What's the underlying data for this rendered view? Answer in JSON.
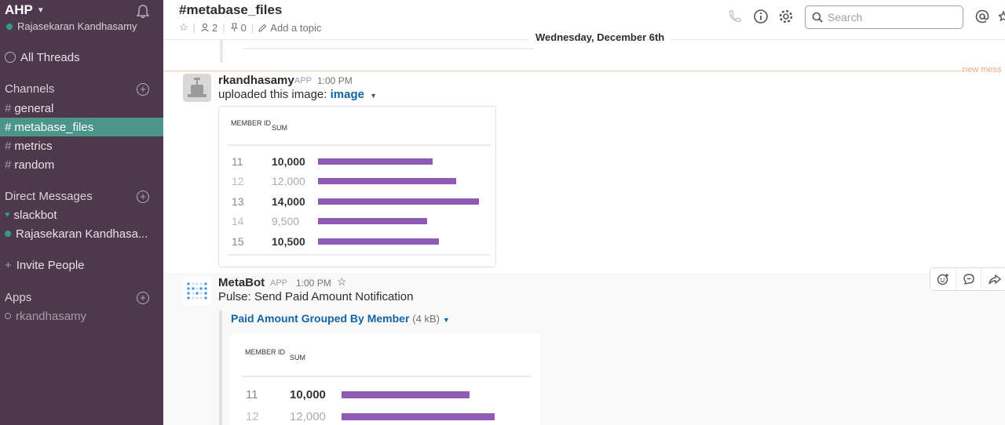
{
  "sidebar": {
    "team_name": "AHP",
    "user_name": "Rajasekaran Kandhasamy",
    "all_threads": "All Threads",
    "channels_heading": "Channels",
    "channels": [
      {
        "label": "general",
        "active": false
      },
      {
        "label": "metabase_files",
        "active": true
      },
      {
        "label": "metrics",
        "active": false
      },
      {
        "label": "random",
        "active": false
      }
    ],
    "dm_heading": "Direct Messages",
    "dms": [
      "slackbot",
      "Rajasekaran Kandhasa..."
    ],
    "invite": "Invite People",
    "apps_heading": "Apps",
    "apps": [
      "rkandhasamy"
    ]
  },
  "header": {
    "channel_title": "#metabase_files",
    "members_count": "2",
    "pins_count": "0",
    "add_topic": "Add a topic",
    "search_placeholder": "Search"
  },
  "date_divider": "Wednesday, December 6th",
  "new_messages_label": "new mess",
  "messages": [
    {
      "author": "rkandhasamy",
      "tag": "APP",
      "time": "1:00 PM",
      "text_prefix": "uploaded this image: ",
      "link": "image",
      "table": {
        "col1": "MEMBER ID",
        "col2": "SUM",
        "rows": [
          {
            "id": "11",
            "sum": "10,000",
            "value": 10000
          },
          {
            "id": "12",
            "sum": "12,000",
            "value": 12000
          },
          {
            "id": "13",
            "sum": "14,000",
            "value": 14000
          },
          {
            "id": "14",
            "sum": "9,500",
            "value": 9500
          },
          {
            "id": "15",
            "sum": "10,500",
            "value": 10500
          }
        ]
      }
    },
    {
      "author": "MetaBot",
      "tag": "APP",
      "time": "1:00 PM",
      "text": "Pulse: Send Paid Amount Notification",
      "attachment_title": "Paid Amount Grouped By Member",
      "attachment_size": "(4 kB)",
      "table": {
        "col1": "MEMBER ID",
        "col2": "SUM",
        "rows": [
          {
            "id": "11",
            "sum": "10,000",
            "value": 10000
          },
          {
            "id": "12",
            "sum": "12,000",
            "value": 12000
          }
        ]
      }
    }
  ],
  "colors": {
    "sidebar_bg": "#4d394b",
    "active_channel": "#4c9689",
    "bar": "#8e5cb7",
    "link": "#1264a3"
  }
}
